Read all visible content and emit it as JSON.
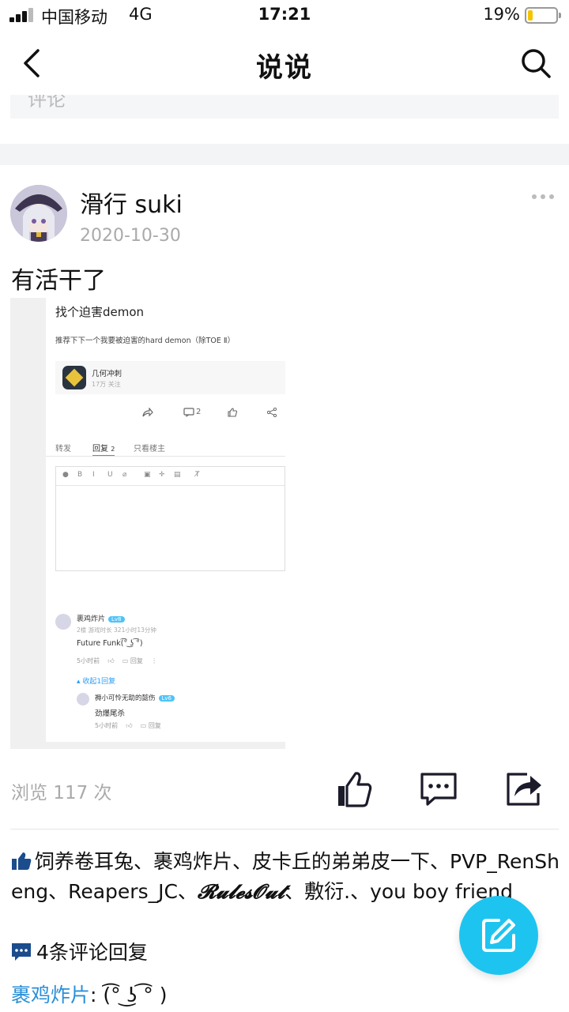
{
  "status_bar": {
    "carrier": "中国移动",
    "network": "4G",
    "time": "17:21",
    "battery": "19%",
    "battery_level": 0.19
  },
  "nav": {
    "title": "说说",
    "back_icon": "back-arrow-icon",
    "search_icon": "search-icon"
  },
  "previous_card": {
    "text": "评论"
  },
  "post": {
    "author": "滑行 suki",
    "date": "2020-10-30",
    "text": "有活干了",
    "more_icon": "more-dots-icon",
    "image": {
      "title": "找个迫害demon",
      "description": "推荐下下一个我要被迫害的hard demon（除TOE Ⅱ）",
      "topic_name": "几何冲刺",
      "topic_followers": "17万 关注",
      "comment_count": "2",
      "tabs": [
        "转发",
        "回复",
        "只看楼主"
      ],
      "reply_count": "2",
      "toolbar": [
        "●",
        "B",
        "I",
        "U",
        "⌀",
        "▣",
        "✛",
        "▤",
        "T̸"
      ],
      "comment": {
        "user": "裹鸡炸片",
        "level": "Lv8",
        "meta": "2楼  游戏时长 321小时13分钟",
        "text": "Future Funk(͡° ͜ʖ ͡°)",
        "time": "5小时前",
        "reply_label": "回复",
        "collapse": "收起1回复"
      },
      "reply": {
        "user": "褥小可怜无助的懿伤",
        "level": "Lv6",
        "text": "劲爆尾杀",
        "time": "5小时前",
        "reply_label": "回复"
      }
    }
  },
  "stats": {
    "views": "浏览 117 次",
    "like_icon": "thumbs-up-icon",
    "comment_icon": "comment-bubble-icon",
    "share_icon": "share-icon"
  },
  "likes": {
    "icon": "thumbs-up-filled-icon",
    "names_before": "饲养卷耳兔、裹鸡炸片、皮卡丘的弟弟皮一下、PVP_RenSheng、Reapers_JC、",
    "fancy_name": "𝓡𝓾𝓵𝓮𝓼𝓞𝓾𝓽",
    "names_after": "、敷衍.、you boy friend"
  },
  "comments": {
    "icon": "comment-filled-icon",
    "count_text": "4条评论回复",
    "first": {
      "user": "裹鸡炸片",
      "separator": ": ",
      "text": "(͡° ͜ʖ ͡° )"
    }
  },
  "fab": {
    "icon": "edit-icon"
  },
  "colors": {
    "accent": "#1ec4f0",
    "link": "#2a8fd8",
    "muted": "#aaaaaa",
    "battery": "#f5c400"
  }
}
